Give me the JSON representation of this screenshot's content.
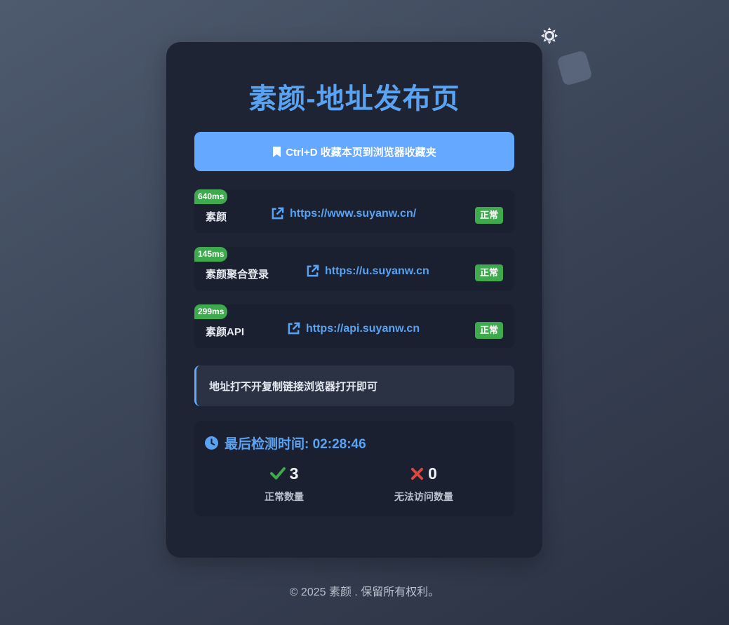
{
  "header": {
    "title": "素颜-地址发布页",
    "bookmark_label": "Ctrl+D 收藏本页到浏览器收藏夹"
  },
  "sites": [
    {
      "latency": "640ms",
      "name": "素颜",
      "url": "https://www.suyanw.cn/",
      "status": "正常"
    },
    {
      "latency": "145ms",
      "name": "素颜聚合登录",
      "url": "https://u.suyanw.cn",
      "status": "正常"
    },
    {
      "latency": "299ms",
      "name": "素颜API",
      "url": "https://api.suyanw.cn",
      "status": "正常"
    }
  ],
  "notice": "地址打不开复制链接浏览器打开即可",
  "check": {
    "time_label": "最后检测时间: 02:28:46",
    "ok_count": "3",
    "ok_label": "正常数量",
    "fail_count": "0",
    "fail_label": "无法访问数量"
  },
  "footer": "© 2025 素颜 . 保留所有权利。",
  "icons": {
    "theme": "sun-icon",
    "bookmark": "bookmark-icon",
    "link": "external-link-icon",
    "clock": "clock-icon",
    "ok": "check-icon",
    "fail": "x-icon"
  },
  "colors": {
    "accent": "#5aa2f2",
    "button": "#64a8ff",
    "success": "#3eaa4d",
    "danger": "#e2453c",
    "card": "#1e2433"
  }
}
